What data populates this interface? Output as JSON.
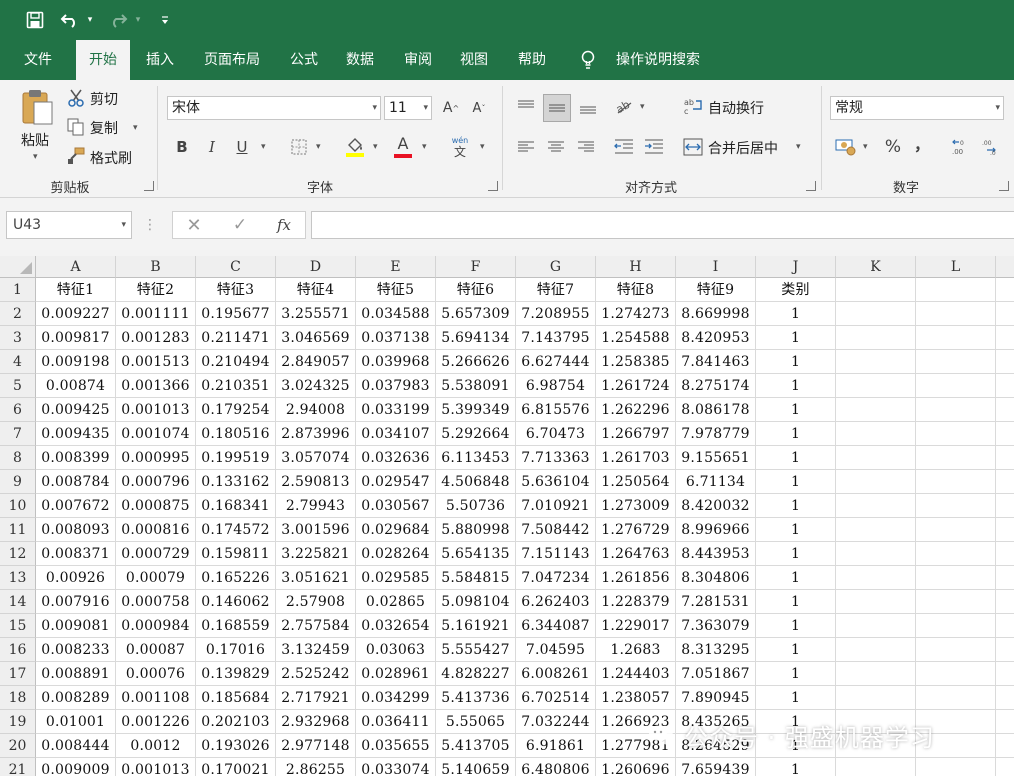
{
  "ribbon_tabs": [
    "文件",
    "开始",
    "插入",
    "页面布局",
    "公式",
    "数据",
    "审阅",
    "视图",
    "帮助"
  ],
  "tell_me": "操作说明搜索",
  "clipboard": {
    "paste": "粘贴",
    "cut": "剪切",
    "copy": "复制",
    "format_painter": "格式刷",
    "group": "剪贴板"
  },
  "font": {
    "name": "宋体",
    "size": "11",
    "bold": "B",
    "italic": "I",
    "underline": "U",
    "font_color_letter": "A",
    "phonetic_top": "wén",
    "phonetic_bottom": "文",
    "group": "字体"
  },
  "alignment": {
    "wrap_text": "自动换行",
    "merge_center": "合并后居中",
    "group": "对齐方式"
  },
  "number": {
    "format": "常规",
    "percent": "%",
    "comma": "，",
    "group": "数字"
  },
  "formula_bar": {
    "name_box": "U43",
    "fx": "fx",
    "content": ""
  },
  "columns": [
    "A",
    "B",
    "C",
    "D",
    "E",
    "F",
    "G",
    "H",
    "I",
    "J",
    "K",
    "L"
  ],
  "headers": [
    "特征1",
    "特征2",
    "特征3",
    "特征4",
    "特征5",
    "特征6",
    "特征7",
    "特征8",
    "特征9",
    "类别"
  ],
  "rows": [
    [
      "0.009227",
      "0.001111",
      "0.195677",
      "3.255571",
      "0.034588",
      "5.657309",
      "7.208955",
      "1.274273",
      "8.669998",
      "1"
    ],
    [
      "0.009817",
      "0.001283",
      "0.211471",
      "3.046569",
      "0.037138",
      "5.694134",
      "7.143795",
      "1.254588",
      "8.420953",
      "1"
    ],
    [
      "0.009198",
      "0.001513",
      "0.210494",
      "2.849057",
      "0.039968",
      "5.266626",
      "6.627444",
      "1.258385",
      "7.841463",
      "1"
    ],
    [
      "0.00874",
      "0.001366",
      "0.210351",
      "3.024325",
      "0.037983",
      "5.538091",
      "6.98754",
      "1.261724",
      "8.275174",
      "1"
    ],
    [
      "0.009425",
      "0.001013",
      "0.179254",
      "2.94008",
      "0.033199",
      "5.399349",
      "6.815576",
      "1.262296",
      "8.086178",
      "1"
    ],
    [
      "0.009435",
      "0.001074",
      "0.180516",
      "2.873996",
      "0.034107",
      "5.292664",
      "6.70473",
      "1.266797",
      "7.978779",
      "1"
    ],
    [
      "0.008399",
      "0.000995",
      "0.199519",
      "3.057074",
      "0.032636",
      "6.113453",
      "7.713363",
      "1.261703",
      "9.155651",
      "1"
    ],
    [
      "0.008784",
      "0.000796",
      "0.133162",
      "2.590813",
      "0.029547",
      "4.506848",
      "5.636104",
      "1.250564",
      "6.71134",
      "1"
    ],
    [
      "0.007672",
      "0.000875",
      "0.168341",
      "2.79943",
      "0.030567",
      "5.50736",
      "7.010921",
      "1.273009",
      "8.420032",
      "1"
    ],
    [
      "0.008093",
      "0.000816",
      "0.174572",
      "3.001596",
      "0.029684",
      "5.880998",
      "7.508442",
      "1.276729",
      "8.996966",
      "1"
    ],
    [
      "0.008371",
      "0.000729",
      "0.159811",
      "3.225821",
      "0.028264",
      "5.654135",
      "7.151143",
      "1.264763",
      "8.443953",
      "1"
    ],
    [
      "0.00926",
      "0.00079",
      "0.165226",
      "3.051621",
      "0.029585",
      "5.584815",
      "7.047234",
      "1.261856",
      "8.304806",
      "1"
    ],
    [
      "0.007916",
      "0.000758",
      "0.146062",
      "2.57908",
      "0.02865",
      "5.098104",
      "6.262403",
      "1.228379",
      "7.281531",
      "1"
    ],
    [
      "0.009081",
      "0.000984",
      "0.168559",
      "2.757584",
      "0.032654",
      "5.161921",
      "6.344087",
      "1.229017",
      "7.363079",
      "1"
    ],
    [
      "0.008233",
      "0.00087",
      "0.17016",
      "3.132459",
      "0.03063",
      "5.555427",
      "7.04595",
      "1.2683",
      "8.313295",
      "1"
    ],
    [
      "0.008891",
      "0.00076",
      "0.139829",
      "2.525242",
      "0.028961",
      "4.828227",
      "6.008261",
      "1.244403",
      "7.051867",
      "1"
    ],
    [
      "0.008289",
      "0.001108",
      "0.185684",
      "2.717921",
      "0.034299",
      "5.413736",
      "6.702514",
      "1.238057",
      "7.890945",
      "1"
    ],
    [
      "0.01001",
      "0.001226",
      "0.202103",
      "2.932968",
      "0.036411",
      "5.55065",
      "7.032244",
      "1.266923",
      "8.435265",
      "1"
    ],
    [
      "0.008444",
      "0.0012",
      "0.193026",
      "2.977148",
      "0.035655",
      "5.413705",
      "6.91861",
      "1.277981",
      "8.264529",
      "1"
    ],
    [
      "0.009009",
      "0.001013",
      "0.170021",
      "2.86255",
      "0.033074",
      "5.140659",
      "6.480806",
      "1.260696",
      "7.659439",
      "1"
    ]
  ],
  "watermark": "公众号 · 强盛机器学习",
  "colors": {
    "excel_green": "#217346",
    "ribbon_bg": "#f3f3f3",
    "font_color_bar": "#e81123",
    "highlight_bar": "#ffff00"
  }
}
